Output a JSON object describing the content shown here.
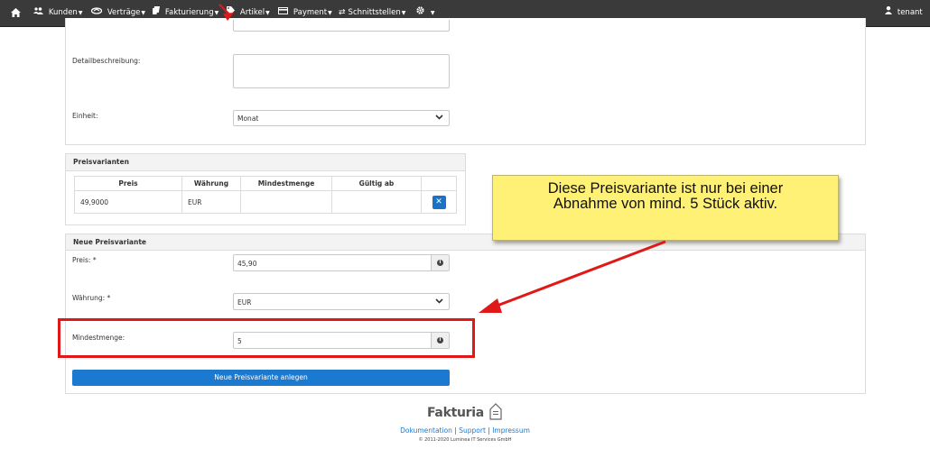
{
  "nav": {
    "home_icon": "home-icon",
    "items": [
      {
        "label": "Kunden",
        "icon": "users-icon"
      },
      {
        "label": "Verträge",
        "icon": "handshake-icon"
      },
      {
        "label": "Fakturierung",
        "icon": "documents-icon"
      },
      {
        "label": "Artikel",
        "icon": "tag-icon"
      },
      {
        "label": "Payment",
        "icon": "credit-card-icon"
      },
      {
        "label": "Schnittstellen",
        "icon": "exchange-icon"
      },
      {
        "label": "",
        "icon": "gear-icon"
      }
    ],
    "user": {
      "label": "tenant",
      "icon": "user-icon"
    }
  },
  "article_form": {
    "detail_label": "Detailbeschreibung:",
    "detail_value": "",
    "unit_label": "Einheit:",
    "unit_value": "Monat"
  },
  "price_variants": {
    "title": "Preisvarianten",
    "columns": [
      "Preis",
      "Währung",
      "Mindestmenge",
      "Gültig ab",
      ""
    ],
    "rows": [
      {
        "price": "49,9000",
        "currency": "EUR",
        "min_qty": "",
        "valid_from": ""
      }
    ]
  },
  "new_variant": {
    "title": "Neue Preisvariante",
    "price_label": "Preis: *",
    "price_value": "45,90",
    "currency_label": "Währung: *",
    "currency_value": "EUR",
    "min_qty_label": "Mindestmenge:",
    "min_qty_value": "5",
    "submit_label": "Neue Preisvariante anlegen"
  },
  "callout": {
    "line1": "Diese Preisvariante ist nur bei einer",
    "line2": "Abnahme von mind. 5 Stück aktiv."
  },
  "footer": {
    "logo_text": "Fakturia",
    "links": [
      "Dokumentation",
      "Support",
      "Impressum"
    ],
    "separator": "|",
    "copyright": "© 2011-2020 Luminea IT Services GmbH"
  },
  "colors": {
    "accent": "#1b7ad0",
    "annotation_red": "#e01818",
    "callout_yellow": "#fff176",
    "navbar": "#3a3a3a"
  }
}
